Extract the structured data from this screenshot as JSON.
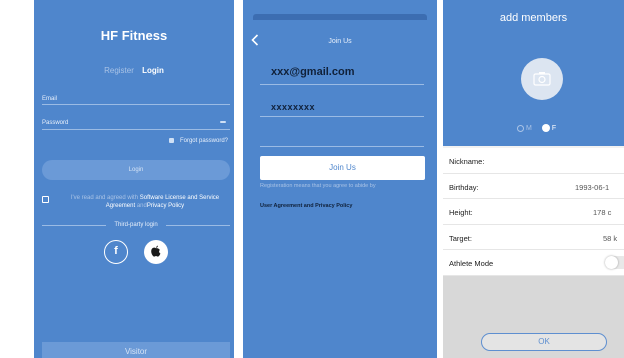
{
  "login_screen": {
    "title": "HF Fitness",
    "tab_register": "Register",
    "tab_login": "Login",
    "email_label": "Email",
    "password_label": "Password",
    "forgot_password": "Forgot password?",
    "login_button": "Login",
    "agree_prefix": "I've read and agreed with",
    "agree_license": "Software License and Service Agreement",
    "agree_and": "and",
    "agree_privacy": "Privacy Policy",
    "third_party_label": "Third-party login",
    "facebook_glyph": "f",
    "visitor_button": "Visitor"
  },
  "join_screen": {
    "nav_title": "Join Us",
    "email_value": "xxx@gmail.com",
    "password_value": "xxxxxxxx",
    "join_button": "Join Us",
    "notice": "Registeration means that you agree to abide by",
    "agreement_links": "User Agreement and Privacy Policy"
  },
  "members_screen": {
    "title": "add members",
    "gender_male": "M",
    "gender_female": "F",
    "rows": [
      {
        "label": "Nickname:",
        "value": ""
      },
      {
        "label": "Birthday:",
        "value": "1993-06-1"
      },
      {
        "label": "Height:",
        "value": "178 c"
      },
      {
        "label": "Target:",
        "value": "58 k"
      },
      {
        "label": "Athlete Mode",
        "value": ""
      }
    ],
    "ok_button": "OK"
  },
  "colors": {
    "primary_blue": "#4f86cc",
    "dark_text": "#10213a"
  }
}
